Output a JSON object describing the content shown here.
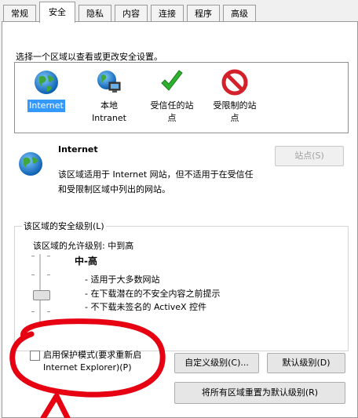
{
  "tabs": [
    {
      "label": "常规"
    },
    {
      "label": "安全"
    },
    {
      "label": "隐私"
    },
    {
      "label": "内容"
    },
    {
      "label": "连接"
    },
    {
      "label": "程序"
    },
    {
      "label": "高级"
    }
  ],
  "active_tab": "安全",
  "instruction": "选择一个区域以查看或更改安全设置。",
  "zones": [
    {
      "line1": "Internet",
      "line2": "",
      "icon": "globe-icon",
      "selected": true
    },
    {
      "line1": "本地",
      "line2": "Intranet",
      "icon": "intranet-icon",
      "selected": false
    },
    {
      "line1": "受信任的站",
      "line2": "点",
      "icon": "checkmark-icon",
      "selected": false
    },
    {
      "line1": "受限制的站",
      "line2": "点",
      "icon": "prohibited-icon",
      "selected": false
    }
  ],
  "zone_detail": {
    "title": "Internet",
    "description_line1": "该区域适用于 Internet 网站，但不适用于在受信任",
    "description_line2": "和受限制区域中列出的网站。",
    "sites_button": "站点(S)"
  },
  "security_level": {
    "group_label": "该区域的安全级别(L)",
    "allowed_levels": "该区域的允许级别: 中到高",
    "level_name": "中-高",
    "bullets": [
      "- 适用于大多数网站",
      "- 在下载潜在的不安全内容之前提示",
      "- 不下载未签名的 ActiveX 控件"
    ]
  },
  "protected_mode": {
    "label_line1": "启用保护模式(要求重新启",
    "label_line2": "Internet Explorer)(P)",
    "checked": false
  },
  "buttons": {
    "custom_level": "自定义级别(C)...",
    "default_level": "默认级别(D)",
    "reset_all": "将所有区域重置为默认级别(R)"
  },
  "colors": {
    "selection": "#3399ff",
    "annotation": "#e60012"
  }
}
